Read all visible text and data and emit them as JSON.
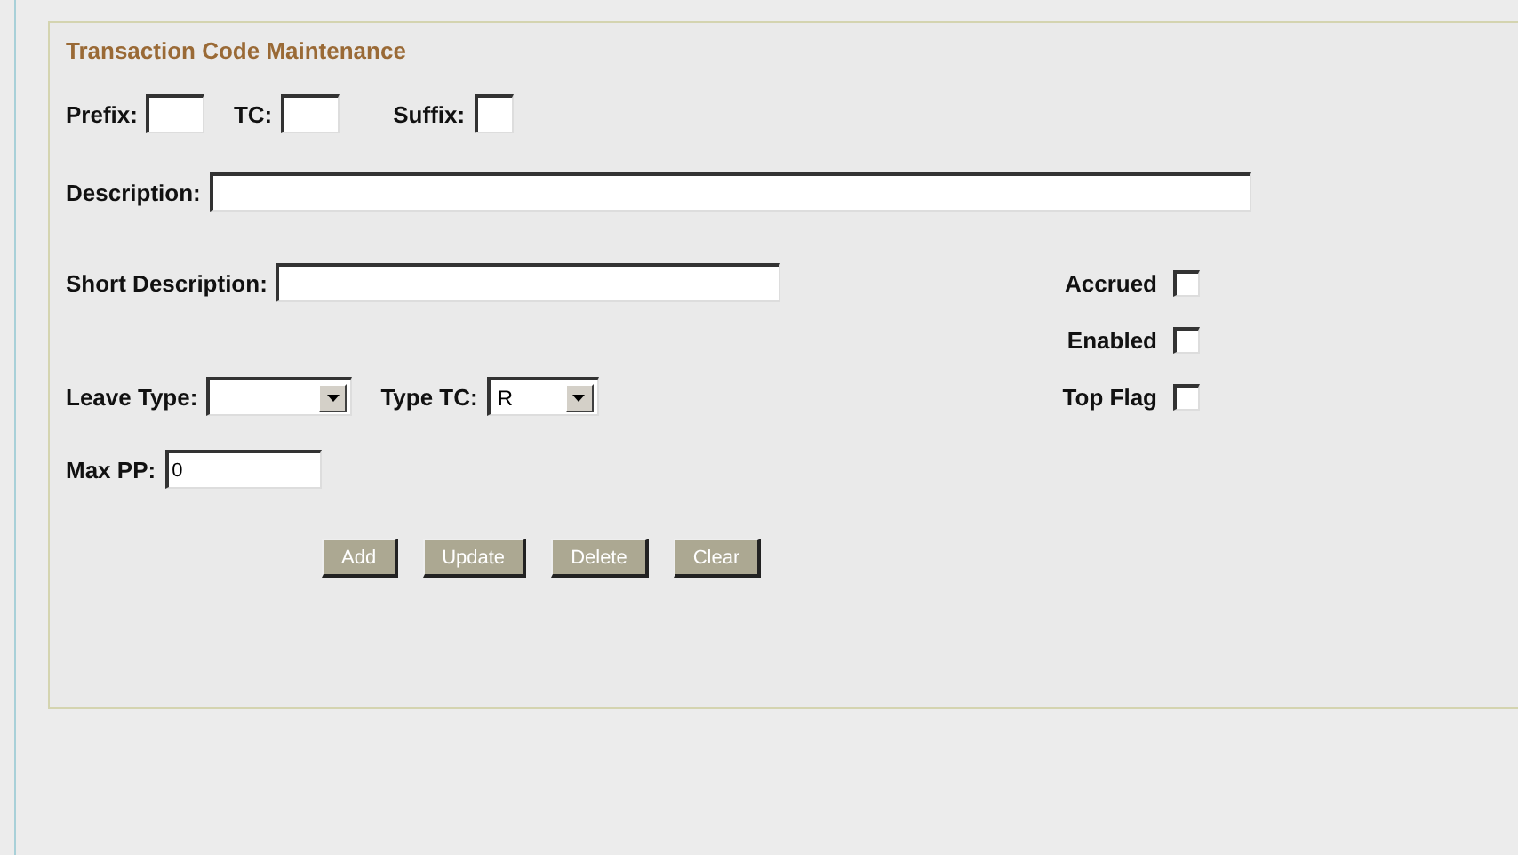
{
  "title": "Transaction Code Maintenance",
  "code_fields": [
    {
      "label": "Prefix:"
    },
    {
      "label": "TC:"
    },
    {
      "label": "Suffix:"
    }
  ],
  "description": {
    "label": "Description:"
  },
  "short_description": {
    "label": "Short Description:"
  },
  "flags": [
    {
      "label": "Accrued",
      "checked": false
    },
    {
      "label": "Enabled",
      "checked": false
    },
    {
      "label": "Top Flag",
      "checked": false
    }
  ],
  "selects": [
    {
      "label": "Leave Type:"
    },
    {
      "label": "Type TC:",
      "value": "R"
    }
  ],
  "max_pp": {
    "label": "Max PP:",
    "value": "0"
  },
  "buttons": [
    "Add",
    "Update",
    "Delete",
    "Clear"
  ]
}
